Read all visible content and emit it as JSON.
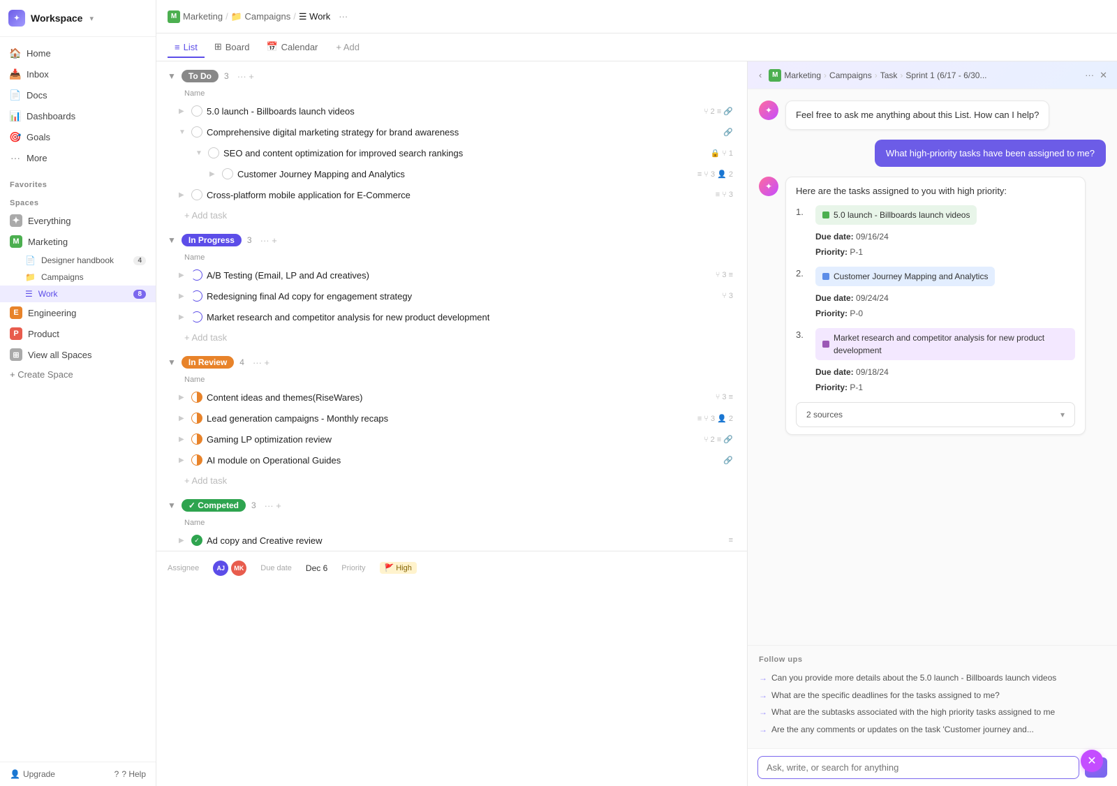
{
  "workspace": {
    "name": "Workspace",
    "chevron": "▾"
  },
  "sidebar": {
    "nav_items": [
      {
        "id": "home",
        "label": "Home",
        "icon": "🏠"
      },
      {
        "id": "inbox",
        "label": "Inbox",
        "icon": "📥"
      },
      {
        "id": "docs",
        "label": "Docs",
        "icon": "📄"
      },
      {
        "id": "dashboards",
        "label": "Dashboards",
        "icon": "📊"
      },
      {
        "id": "goals",
        "label": "Goals",
        "icon": "🎯"
      },
      {
        "id": "more",
        "label": "More",
        "icon": "···"
      }
    ],
    "favorites_label": "Favorites",
    "spaces_label": "Spaces",
    "spaces": [
      {
        "id": "everything",
        "label": "Everything",
        "icon": "✦",
        "icon_bg": "#aaa"
      },
      {
        "id": "marketing",
        "label": "Marketing",
        "icon": "M",
        "icon_bg": "#4caf50"
      },
      {
        "id": "engineering",
        "label": "Engineering",
        "icon": "E",
        "icon_bg": "#e8832a"
      },
      {
        "id": "product",
        "label": "Product",
        "icon": "P",
        "icon_bg": "#e85c4d"
      },
      {
        "id": "view-all",
        "label": "View all Spaces",
        "icon": "⊞",
        "icon_bg": "#aaa"
      }
    ],
    "marketing_sub": [
      {
        "id": "designer-handbook",
        "label": "Designer handbook",
        "icon": "📄",
        "badge": "4"
      },
      {
        "id": "campaigns",
        "label": "Campaigns",
        "icon": "📁",
        "badge": ""
      },
      {
        "id": "work",
        "label": "Work",
        "icon": "☰",
        "badge": "8",
        "active": true
      }
    ],
    "create_space_label": "+ Create Space",
    "footer": {
      "upgrade": "Upgrade",
      "help": "? Help"
    }
  },
  "topbar": {
    "breadcrumb": [
      "M Marketing",
      "/",
      "Campaigns",
      "/",
      "Work"
    ],
    "more_icon": "···"
  },
  "tabs": [
    {
      "id": "list",
      "label": "List",
      "icon": "≡",
      "active": true
    },
    {
      "id": "board",
      "label": "Board",
      "icon": "⊞"
    },
    {
      "id": "calendar",
      "label": "Calendar",
      "icon": "📅"
    },
    {
      "id": "add",
      "label": "+ Add"
    }
  ],
  "sections": [
    {
      "id": "todo",
      "label": "To Do",
      "badge_class": "badge-todo",
      "count": "3",
      "tasks": [
        {
          "id": "t1",
          "name": "5.0 launch - Billboards launch videos",
          "meta": "⑂ 2 ≡ 🔗",
          "indent": 0,
          "check": "empty"
        },
        {
          "id": "t2",
          "name": "Comprehensive digital marketing strategy for brand awareness",
          "meta": "🔗",
          "indent": 0,
          "check": "empty",
          "expanded": true
        },
        {
          "id": "t3",
          "name": "SEO and content optimization for improved search rankings",
          "meta": "🔒 ⑂ 1",
          "indent": 1,
          "check": "empty",
          "expanded": true
        },
        {
          "id": "t4",
          "name": "Customer Journey Mapping and Analytics",
          "meta": "≡ ⑂ 3 👤 2",
          "indent": 2,
          "check": "empty"
        },
        {
          "id": "t5",
          "name": "Cross-platform mobile application for E-Commerce",
          "meta": "≡ ⑂ 3",
          "indent": 0,
          "check": "empty"
        }
      ]
    },
    {
      "id": "inprogress",
      "label": "In Progress",
      "badge_class": "badge-inprogress",
      "count": "3",
      "tasks": [
        {
          "id": "t6",
          "name": "A/B Testing (Email, LP and Ad creatives)",
          "meta": "⑂ 3 ≡",
          "indent": 0,
          "check": "in-progress"
        },
        {
          "id": "t7",
          "name": "Redesigning final Ad copy for engagement strategy",
          "meta": "⑂ 3",
          "indent": 0,
          "check": "in-progress"
        },
        {
          "id": "t8",
          "name": "Market research and competitor analysis for new product development",
          "meta": "",
          "indent": 0,
          "check": "in-progress"
        }
      ]
    },
    {
      "id": "inreview",
      "label": "In Review",
      "badge_class": "badge-inreview",
      "count": "4",
      "tasks": [
        {
          "id": "t9",
          "name": "Content ideas and themes(RiseWares)",
          "meta": "⑂ 3 ≡",
          "indent": 0,
          "check": "in-review"
        },
        {
          "id": "t10",
          "name": "Lead generation campaigns - Monthly recaps",
          "meta": "≡ ⑂ 3 👤 2",
          "indent": 0,
          "check": "in-review"
        },
        {
          "id": "t11",
          "name": "Gaming LP optimization review",
          "meta": "⑂ 2 ≡ 🔗",
          "indent": 0,
          "check": "in-review"
        },
        {
          "id": "t12",
          "name": "AI module on Operational Guides",
          "meta": "🔗",
          "indent": 0,
          "check": "in-review"
        }
      ]
    },
    {
      "id": "completed",
      "label": "Competed",
      "badge_class": "badge-completed",
      "count": "3",
      "tasks": [
        {
          "id": "t13",
          "name": "Ad copy and Creative review",
          "meta": "≡",
          "indent": 0,
          "check": "completed"
        }
      ]
    }
  ],
  "ai_panel": {
    "back_icon": "‹",
    "breadcrumb": [
      "M Marketing",
      ">",
      "Campaigns",
      ">",
      "Task",
      ">",
      "Sprint 1 (6/17 - 6/30..."
    ],
    "more_icon": "···",
    "close_icon": "✕",
    "ai_avatar_icon": "✦",
    "welcome_msg": "Feel free to ask me anything about this List. How can I help?",
    "user_msg": "What high-priority tasks have been assigned to me?",
    "ai_response_intro": "Here are the tasks assigned to you with high priority:",
    "tasks": [
      {
        "num": "1.",
        "name": "5.0 launch - Billboards launch videos",
        "color": "#4caf50",
        "due_label": "Due date:",
        "due": "09/16/24",
        "priority_label": "Priority:",
        "priority": "P-1"
      },
      {
        "num": "2.",
        "name": "Customer Journey Mapping and Analytics",
        "color": "#5c8de8",
        "due_label": "Due date:",
        "due": "09/24/24",
        "priority_label": "Priority:",
        "priority": "P-0"
      },
      {
        "num": "3.",
        "name": "Market research and competitor analysis for new product development",
        "color": "#9b59b6",
        "due_label": "Due date:",
        "due": "09/18/24",
        "priority_label": "Priority:",
        "priority": "P-1"
      }
    ],
    "sources_label": "2 sources",
    "followups_label": "Follow ups",
    "followups": [
      "Can you provide more details about the 5.0 launch - Billboards launch videos",
      "What are the specific deadlines for the tasks assigned to me?",
      "What are the subtasks associated with the high priority tasks assigned to me",
      "Are the any comments or updates on the task 'Customer journey and..."
    ],
    "input_placeholder": "Ask, write, or search for anything",
    "send_icon": "➤"
  },
  "bottom_bar": {
    "assignee_label": "Assignee",
    "due_date_label": "Due date",
    "due_date_value": "Dec 6",
    "priority_label": "Priority",
    "priority_value": "High",
    "priority_flag": "🚩",
    "refresh_icon": "✕"
  }
}
